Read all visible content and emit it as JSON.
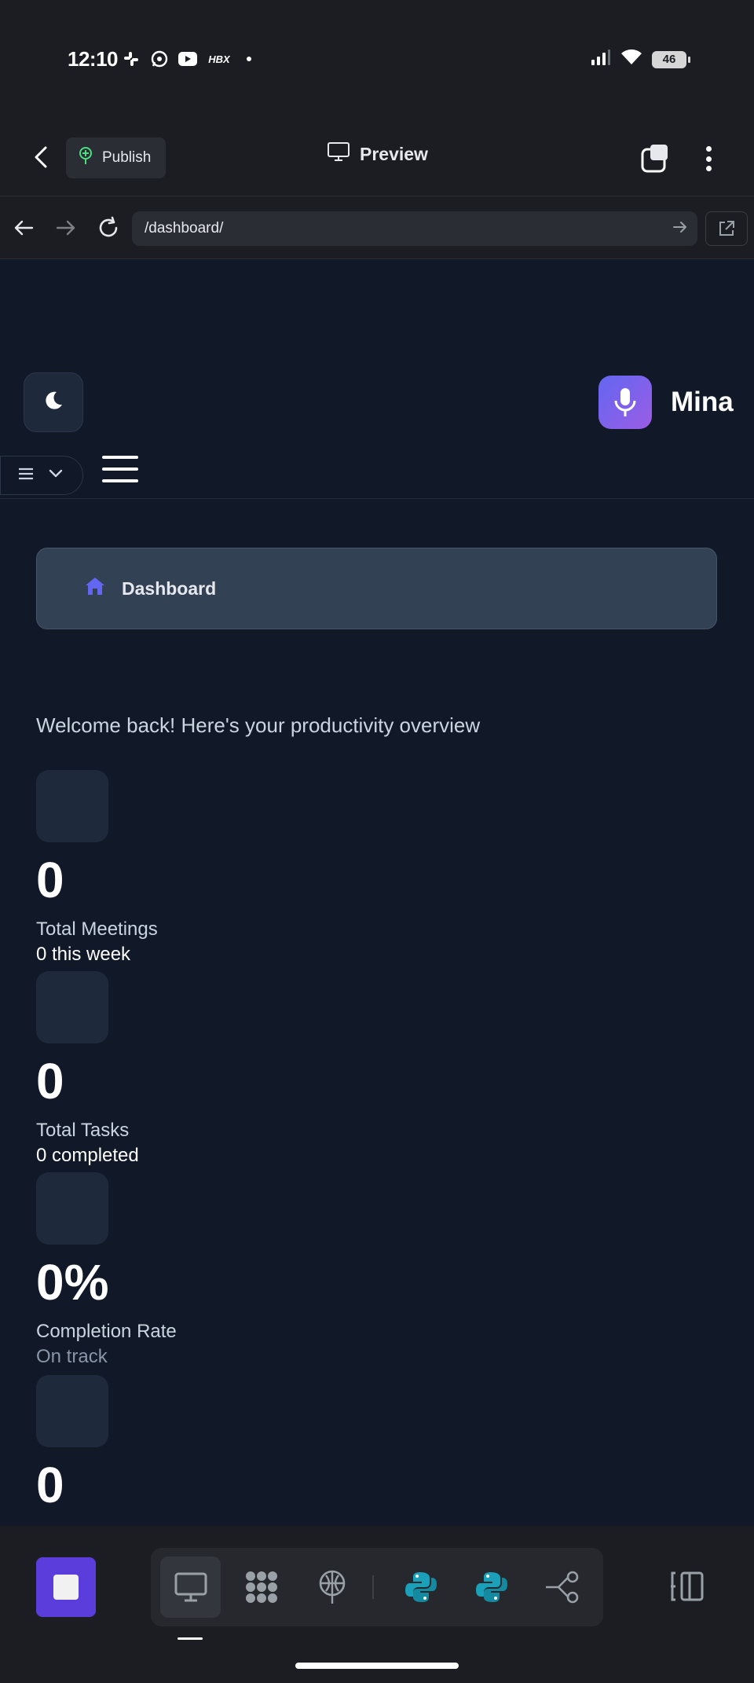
{
  "status_bar": {
    "time": "12:10",
    "notification_icons": [
      "slack-icon",
      "whatsapp-icon",
      "youtube-icon",
      "hbx-icon"
    ],
    "hbx_text": "HBX",
    "battery": "46"
  },
  "app_header": {
    "publish_label": "Publish",
    "preview_label": "Preview"
  },
  "browser": {
    "url": "/dashboard/"
  },
  "web": {
    "brand_name": "Mina",
    "breadcrumb_label": "Dashboard",
    "welcome_text": "Welcome back! Here's your productivity overview",
    "stats": [
      {
        "value": "0",
        "label": "Total Meetings",
        "sub": "0 this week"
      },
      {
        "value": "0",
        "label": "Total Tasks",
        "sub": "0 completed"
      },
      {
        "value": "0%",
        "label": "Completion Rate",
        "sub": "On track"
      },
      {
        "value": "0",
        "label": "",
        "sub": ""
      }
    ]
  },
  "toolbar": {
    "tools": [
      "desktop-icon",
      "cluster-icon",
      "deploy-icon",
      "python-icon",
      "python-icon",
      "workflow-icon"
    ],
    "accent": "#5b3ddc",
    "python_color": "#1aa0b8"
  },
  "colors": {
    "page_bg": "#111827",
    "chrome_bg": "#1b1d22",
    "card_bg": "#1e293b",
    "brand_gradient_start": "#6366f1",
    "brand_gradient_end": "#9b5de5"
  }
}
